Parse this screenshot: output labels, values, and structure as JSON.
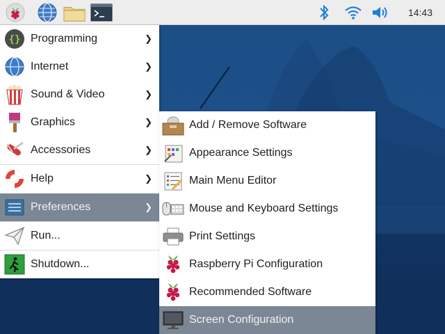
{
  "taskbar": {
    "launchers": [
      {
        "name": "raspberry-menu-icon"
      },
      {
        "name": "web-browser-icon"
      },
      {
        "name": "file-manager-icon"
      },
      {
        "name": "terminal-icon"
      }
    ],
    "tray": [
      "bluetooth-icon",
      "wifi-icon",
      "volume-icon"
    ],
    "clock": "14:43"
  },
  "main_menu": {
    "items": [
      {
        "label": "Programming",
        "icon": "programming-icon",
        "submenu": true
      },
      {
        "label": "Internet",
        "icon": "internet-icon",
        "submenu": true
      },
      {
        "label": "Sound & Video",
        "icon": "sound-video-icon",
        "submenu": true
      },
      {
        "label": "Graphics",
        "icon": "graphics-icon",
        "submenu": true
      },
      {
        "label": "Accessories",
        "icon": "accessories-icon",
        "submenu": true
      },
      {
        "label": "Help",
        "icon": "help-icon",
        "submenu": true
      },
      {
        "label": "Preferences",
        "icon": "preferences-icon",
        "submenu": true,
        "active": true
      },
      {
        "label": "Run...",
        "icon": "run-icon",
        "submenu": false
      },
      {
        "label": "Shutdown...",
        "icon": "shutdown-icon",
        "submenu": false
      }
    ],
    "arrow": "❯"
  },
  "preferences_menu": {
    "items": [
      {
        "label": "Add / Remove Software",
        "icon": "add-remove-software-icon"
      },
      {
        "label": "Appearance Settings",
        "icon": "appearance-settings-icon"
      },
      {
        "label": "Main Menu Editor",
        "icon": "main-menu-editor-icon"
      },
      {
        "label": "Mouse and Keyboard Settings",
        "icon": "mouse-keyboard-icon"
      },
      {
        "label": "Print Settings",
        "icon": "printer-icon"
      },
      {
        "label": "Raspberry Pi Configuration",
        "icon": "raspberry-icon"
      },
      {
        "label": "Recommended Software",
        "icon": "raspberry-icon"
      },
      {
        "label": "Screen Configuration",
        "icon": "monitor-icon",
        "active": true
      }
    ]
  },
  "colors": {
    "taskbar": "#ededed",
    "menu_highlight": "#7b8794",
    "wallpaper": "#1d4f8a"
  }
}
